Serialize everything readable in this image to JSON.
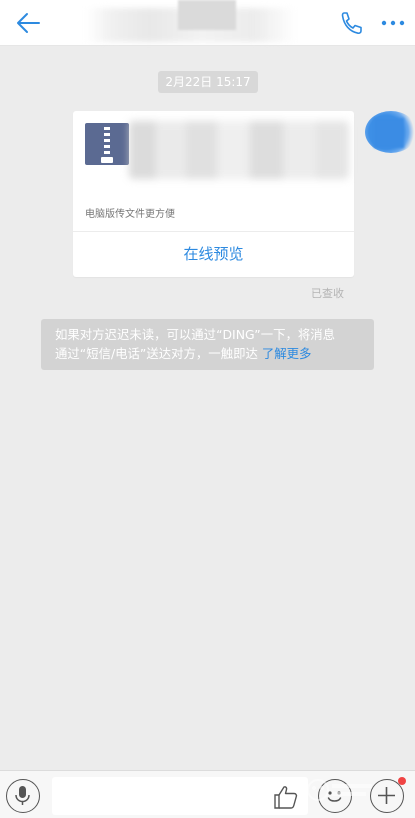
{
  "header": {
    "back_icon": "arrow-left-icon",
    "phone_icon": "phone-icon",
    "more_icon": "more-horizontal-icon",
    "accent": "#2d8ae0"
  },
  "chat": {
    "timestamp": "2月22日 15:17",
    "file_card": {
      "file_icon": "zip-file-icon",
      "hint": "电脑版传文件更方便",
      "preview_label": "在线预览"
    },
    "read_status": "已查收",
    "notice": {
      "line1": "如果对方迟迟未读，可以通过“DING”一下，将消息",
      "line2": "通过“短信/电话”送达对方，一触即达 ",
      "link": "了解更多"
    }
  },
  "composer": {
    "mic_icon": "microphone-icon",
    "input_value": "",
    "input_placeholder": "",
    "like_icon": "thumbs-up-icon",
    "emoji_icon": "emoji-icon",
    "plus_icon": "plus-icon",
    "badge_color": "#f04444"
  }
}
